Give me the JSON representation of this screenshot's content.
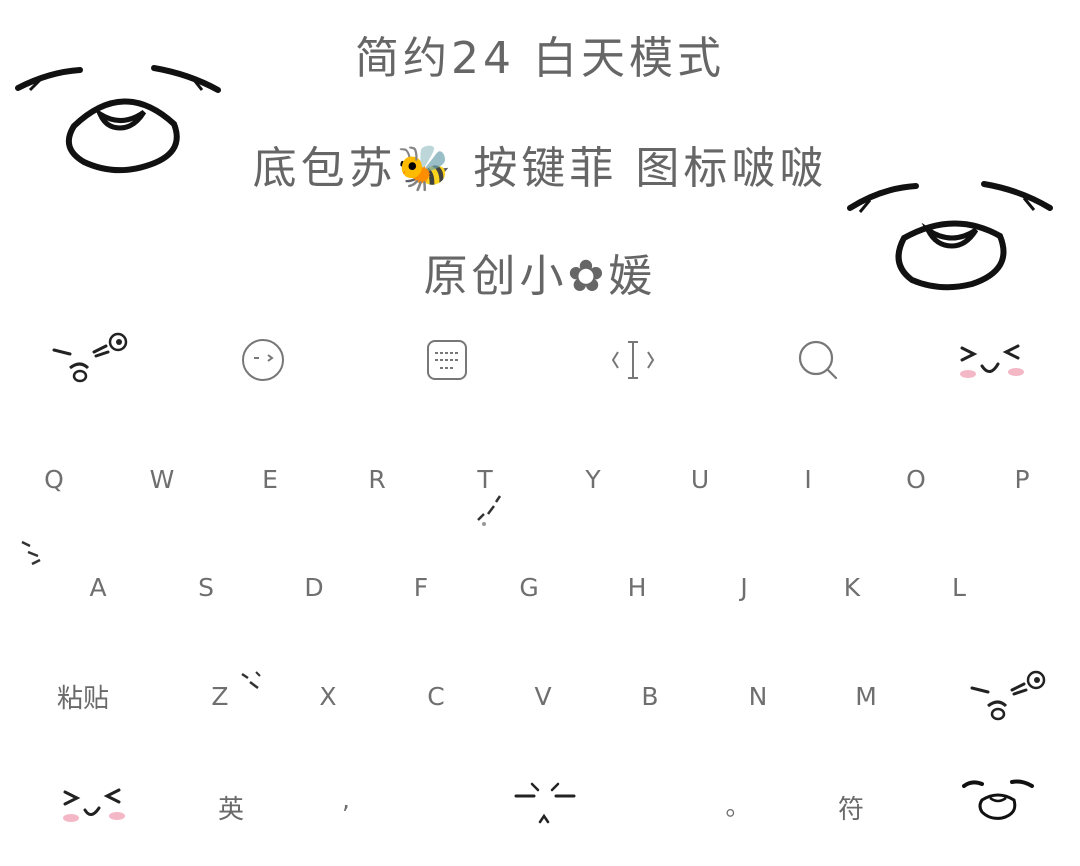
{
  "header": {
    "title_line1": "简约24  白天模式",
    "title_line2": "底包苏🐝 按键菲 图标啵啵",
    "title_line3": "原创小✿媛"
  },
  "toolbar": {
    "icons": [
      "kaomoji-wink-icon",
      "emoji-face-icon",
      "keyboard-icon",
      "cursor-icon",
      "search-icon",
      "kaomoji-happy-icon"
    ]
  },
  "keyboard": {
    "row1": [
      "Q",
      "W",
      "E",
      "R",
      "T",
      "Y",
      "U",
      "I",
      "O",
      "P"
    ],
    "row2": [
      "A",
      "S",
      "D",
      "F",
      "G",
      "H",
      "J",
      "K",
      "L"
    ],
    "row3": [
      "粘贴",
      "Z",
      "X",
      "C",
      "V",
      "B",
      "N",
      "M"
    ],
    "row4": {
      "lang": "英",
      "comma": ",",
      "period": "。",
      "symbols": "符"
    }
  },
  "colors": {
    "background": "#ffffff",
    "key_text": "#6f6f6f",
    "title": "#666666",
    "blush": "#f4b7c6"
  }
}
